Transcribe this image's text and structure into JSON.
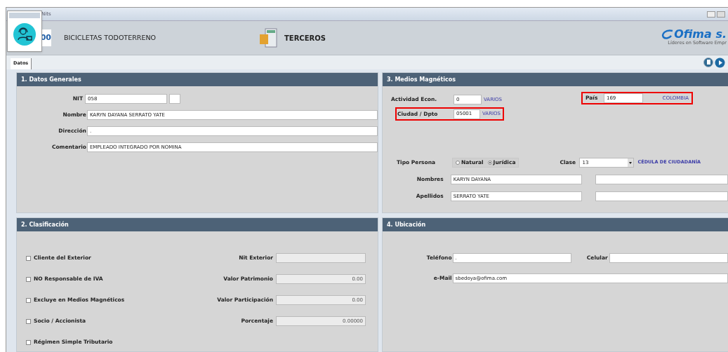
{
  "window": {
    "title": "Nits"
  },
  "header": {
    "logo_fragment": "00",
    "company": "BICICLETAS TODOTERRENO",
    "module": "TERCEROS",
    "brand": {
      "name": "Ofima s.",
      "tagline": "Líderes en Software Empr"
    }
  },
  "tabs": [
    {
      "label": "Datos",
      "selected": true
    }
  ],
  "datos_generales": {
    "title": "1. Datos  Generales",
    "nit": {
      "label": "NIT",
      "value": "058"
    },
    "fields": [
      {
        "label": "Nombre",
        "value": "KARYN DAYANA  SERRATO YATE"
      },
      {
        "label": "Dirección",
        "value": "."
      },
      {
        "label": "Comentario",
        "value": "EMPLEADO INTEGRADO POR NOMINA"
      }
    ]
  },
  "medios_magneticos": {
    "title": "3. Medios Magnéticos",
    "actividad": {
      "label": "Actividad Econ.",
      "value": "0",
      "description": "VARIOS"
    },
    "pais": {
      "label": "País",
      "value": "169",
      "description": "COLOMBIA",
      "highlighted": true
    },
    "ciudad": {
      "label": "Ciudad / Dpto",
      "value": "05001",
      "description": "VARIOS",
      "highlighted": true
    },
    "tipo_persona": {
      "label": "Tipo Persona",
      "options": [
        {
          "label": "Natural",
          "selected": false
        },
        {
          "label": "Jurídica",
          "selected": true
        }
      ]
    },
    "clase": {
      "label": "Clase",
      "value": "13",
      "description": "CÉDULA DE CIUDADANÍA"
    },
    "nombres": {
      "label": "Nombres",
      "value": "KARYN DAYANA"
    },
    "apellidos": {
      "label": "Apellidos",
      "value": "SERRATO YATE"
    }
  },
  "clasificacion": {
    "title": "2. Clasificación",
    "checkboxes": [
      {
        "label": "Cliente del Exterior",
        "checked": false
      },
      {
        "label": "NO Responsable de IVA",
        "checked": false
      },
      {
        "label": "Excluye en Medios Magnéticos",
        "checked": false
      },
      {
        "label": "Socio / Accionista",
        "checked": false
      },
      {
        "label": "Régimen Simple Tributario",
        "checked": false
      }
    ],
    "fields": [
      {
        "label": "Nit Exterior"
      },
      {
        "label": "Valor Patrimonio",
        "value": "0.00"
      },
      {
        "label": "Valor Participación",
        "value": "0.00"
      },
      {
        "label": "Porcentaje",
        "value": "0.00000"
      }
    ]
  },
  "ubicacion": {
    "title": "4. Ubicación",
    "telefono": {
      "label": "Teléfono",
      "value": "."
    },
    "celular": {
      "label": "Celular"
    },
    "email": {
      "label": "e-Mail",
      "value": "sbedoya@ofima.com"
    }
  }
}
